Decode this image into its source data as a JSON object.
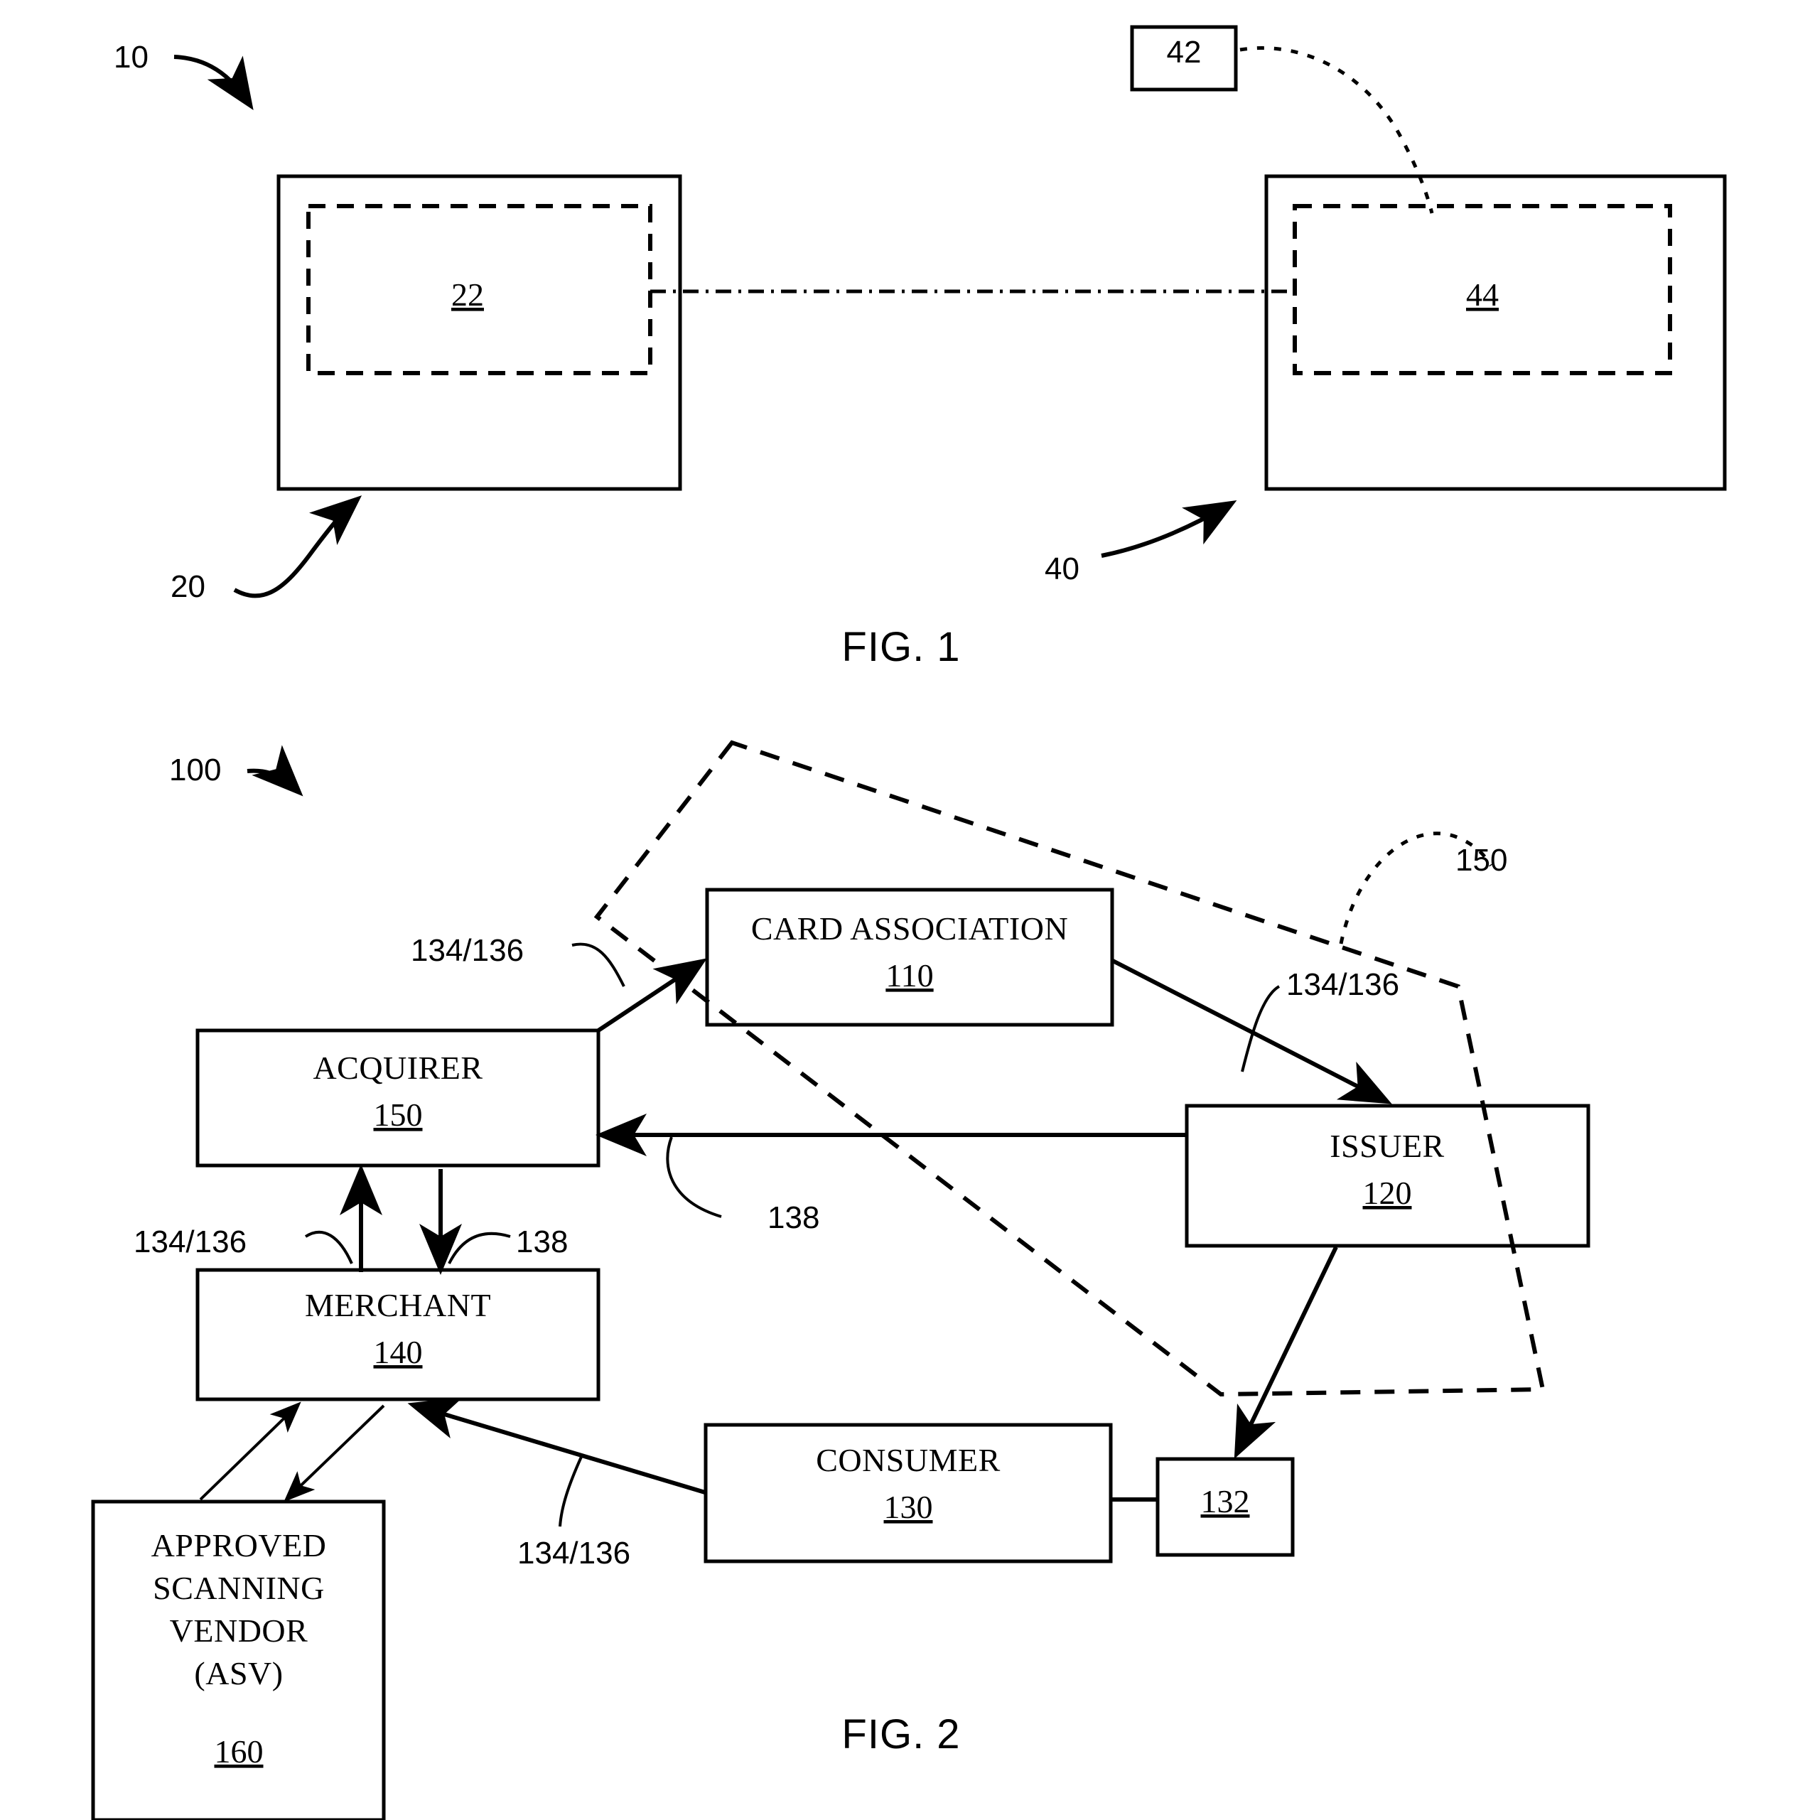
{
  "document": {
    "type": "patent-drawing-sheet",
    "figure_count": 2
  },
  "figure1": {
    "caption": "FIG. 1",
    "system_ref": "10",
    "left_outer_ref": "20",
    "left_inner_ref": "22",
    "right_outer_ref": "40",
    "right_inner_ref": "44",
    "small_box_ref": "42",
    "elements": [
      {
        "name": "left-outer-box",
        "ref": "20",
        "style": "solid"
      },
      {
        "name": "left-inner-box",
        "ref": "22",
        "style": "dashed"
      },
      {
        "name": "right-outer-box",
        "ref": "40",
        "style": "solid"
      },
      {
        "name": "right-inner-box",
        "ref": "44",
        "style": "dashed"
      },
      {
        "name": "small-box",
        "ref": "42",
        "style": "solid"
      }
    ],
    "connections": [
      {
        "from": "22",
        "to": "44",
        "style": "dash-dot-dot"
      },
      {
        "from": "42",
        "to": "44",
        "style": "dotted-lead"
      }
    ]
  },
  "figure2": {
    "caption": "FIG. 2",
    "system_ref": "100",
    "boundary_ref": "150",
    "boxes": [
      {
        "name": "card-association",
        "title": "CARD ASSOCIATION",
        "ref": "110"
      },
      {
        "name": "acquirer",
        "title": "ACQUIRER",
        "ref": "150"
      },
      {
        "name": "issuer",
        "title": "ISSUER",
        "ref": "120"
      },
      {
        "name": "merchant",
        "title": "MERCHANT",
        "ref": "140"
      },
      {
        "name": "consumer",
        "title": "CONSUMER",
        "ref": "130"
      },
      {
        "name": "payment-card",
        "title": "",
        "ref": "132"
      },
      {
        "name": "approved-scanning-vendor",
        "title_lines": [
          "APPROVED",
          "SCANNING",
          "VENDOR",
          "(ASV)"
        ],
        "ref": "160"
      }
    ],
    "flow_labels": {
      "acquirer_to_card_association": "134/136",
      "card_association_to_issuer": "134/136",
      "merchant_to_acquirer": "134/136",
      "acquirer_to_merchant": "138",
      "issuer_to_acquirer": "138",
      "consumer_to_merchant": "134/136"
    },
    "asv_box_lines": [
      "APPROVED",
      "SCANNING",
      "VENDOR",
      "(ASV)"
    ],
    "asv_ref": "160"
  },
  "colors": {
    "ink": "#000000",
    "paper": "#ffffff"
  }
}
